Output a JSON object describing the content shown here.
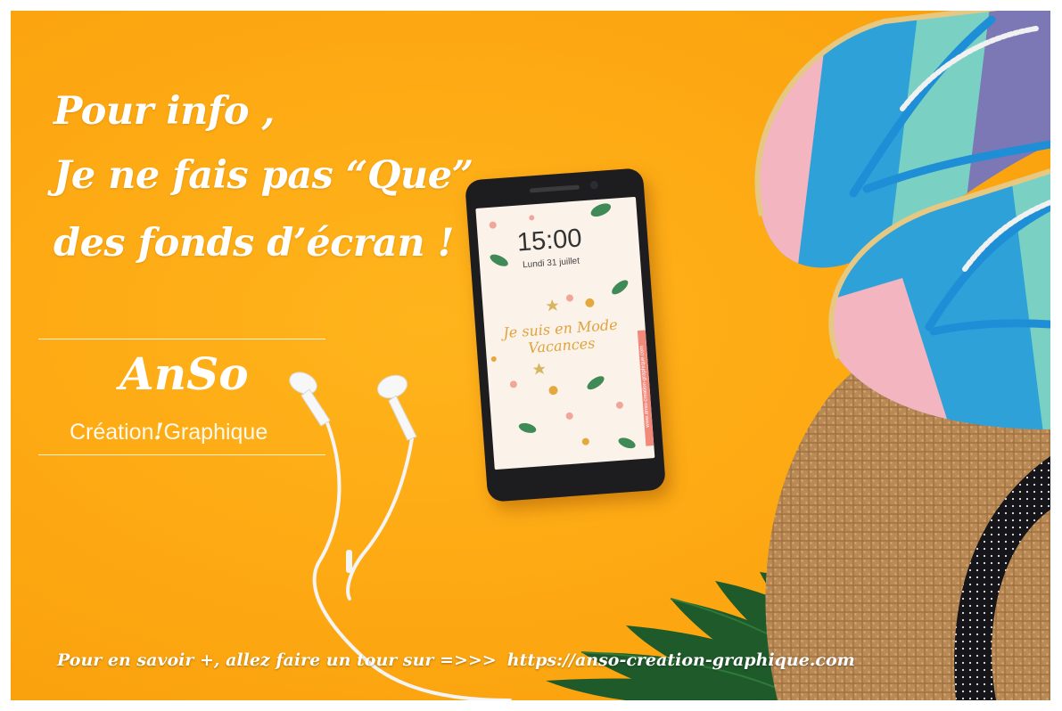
{
  "headline": {
    "line1": "Pour info ,",
    "line2": "Je ne fais pas “Que”",
    "line3": "des fonds d’écran !"
  },
  "logo": {
    "name": "AnSo",
    "tagline_left": "Création",
    "tagline_mark": "!",
    "tagline_right": "Graphique"
  },
  "phone_screen": {
    "time": "15:00",
    "date": "Lundi 31 juillet",
    "quote_line1": "Je suis en Mode",
    "quote_line2": "Vacances",
    "side_url": "www.anso-creation-graphique.com"
  },
  "footer": {
    "lead": "Pour en savoir +, allez faire un tour sur =>>>",
    "url": "https://anso-creation-graphique.com"
  },
  "colors": {
    "background": "#fda812",
    "text": "#ffffff",
    "flipflop_stripes": [
      "#f3b5bf",
      "#2ea2d8",
      "#7ad1c3",
      "#7c78b6"
    ],
    "hat": "#b98a55",
    "leaf": "#1f5a2a"
  }
}
